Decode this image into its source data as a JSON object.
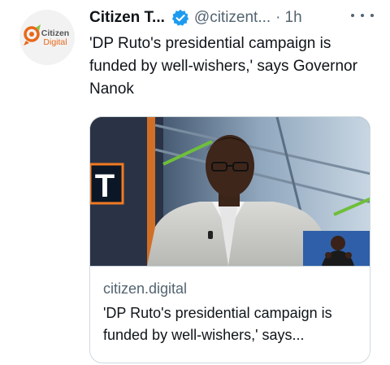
{
  "author": {
    "display_name": "Citizen T...",
    "handle": "@citizent...",
    "separator": "·",
    "timestamp": "1h",
    "verified": true,
    "avatar_text": [
      "Citizen",
      "Digital"
    ],
    "brand_color": "#e8681a"
  },
  "tweet": {
    "text": "'DP Ruto's presidential campaign is funded by well-wishers,' says Governor Nanok"
  },
  "card": {
    "domain": "citizen.digital",
    "title": "'DP Ruto's presidential campaign is funded by well-wishers,' says...",
    "media_badge_letter": "T"
  },
  "colors": {
    "text_primary": "#0f1419",
    "text_secondary": "#536471",
    "verified_blue": "#1d9bf0",
    "card_border": "#cfd9de"
  },
  "icons": {
    "verified": "verified-badge-icon",
    "more": "more-horizontal-icon"
  }
}
